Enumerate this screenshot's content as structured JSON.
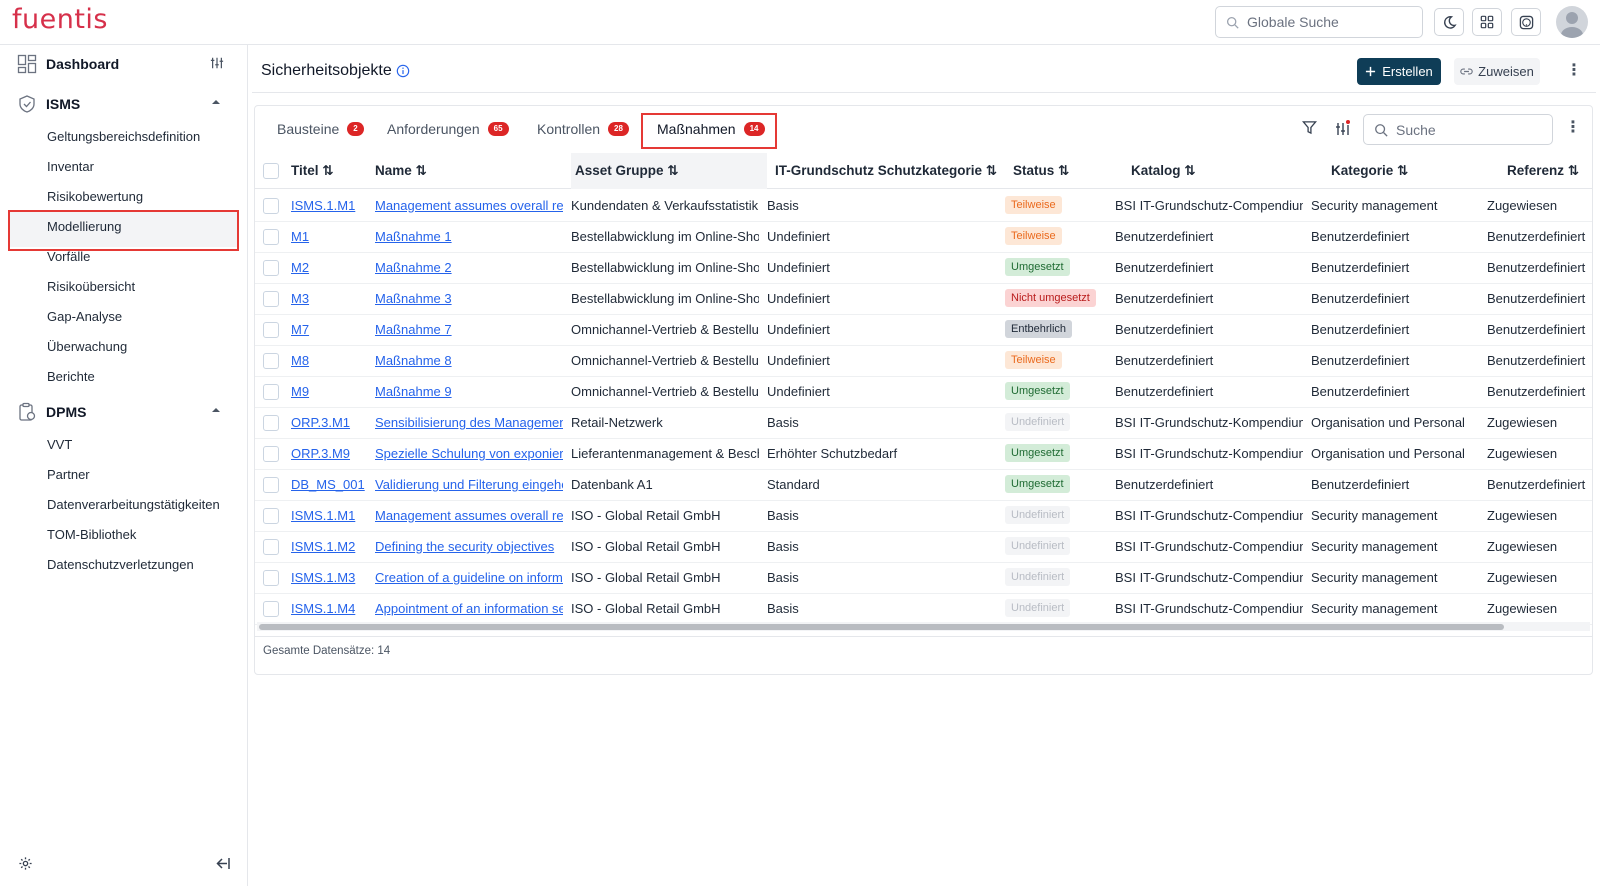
{
  "app": {
    "logo": "fuentis"
  },
  "header": {
    "search_placeholder": "Globale Suche"
  },
  "sidebar": {
    "dashboard": "Dashboard",
    "isms": {
      "label": "ISMS",
      "items": [
        "Geltungsbereichsdefinition",
        "Inventar",
        "Risikobewertung",
        "Modellierung",
        "Vorfälle",
        "Risikoübersicht",
        "Gap-Analyse",
        "Überwachung",
        "Berichte"
      ],
      "active": "Modellierung"
    },
    "dpms": {
      "label": "DPMS",
      "items": [
        "VVT",
        "Partner",
        "Datenverarbeitungstätigkeiten",
        "TOM-Bibliothek",
        "Datenschutzverletzungen"
      ]
    }
  },
  "page": {
    "title": "Sicherheitsobjekte",
    "create_label": "Erstellen",
    "assign_label": "Zuweisen"
  },
  "tabs": [
    {
      "label": "Bausteine",
      "count": "2"
    },
    {
      "label": "Anforderungen",
      "count": "65"
    },
    {
      "label": "Kontrollen",
      "count": "28"
    },
    {
      "label": "Maßnahmen",
      "count": "14"
    }
  ],
  "active_tab": "Maßnahmen",
  "table_search_placeholder": "Suche",
  "columns": [
    "Titel",
    "Name",
    "Asset Gruppe",
    "IT-Grundschutz Schutzkategorie",
    "Status",
    "Katalog",
    "Kategorie",
    "Referenz"
  ],
  "rows": [
    [
      "ISMS.1.M1",
      "Management assumes overall responsibility",
      "Kundendaten & Verkaufsstatistik",
      "Basis",
      "Teilweise",
      "BSI IT-Grundschutz-Compendium",
      "Security management",
      "Zugewiesen"
    ],
    [
      "M1",
      "Maßnahme 1",
      "Bestellabwicklung im Online-Shop",
      "Undefiniert",
      "Teilweise",
      "Benutzerdefiniert",
      "Benutzerdefiniert",
      "Benutzerdefiniert"
    ],
    [
      "M2",
      "Maßnahme 2",
      "Bestellabwicklung im Online-Shop",
      "Undefiniert",
      "Umgesetzt",
      "Benutzerdefiniert",
      "Benutzerdefiniert",
      "Benutzerdefiniert"
    ],
    [
      "M3",
      "Maßnahme 3",
      "Bestellabwicklung im Online-Shop",
      "Undefiniert",
      "Nicht umgesetzt",
      "Benutzerdefiniert",
      "Benutzerdefiniert",
      "Benutzerdefiniert"
    ],
    [
      "M7",
      "Maßnahme 7",
      "Omnichannel-Vertrieb & Bestellung",
      "Undefiniert",
      "Entbehrlich",
      "Benutzerdefiniert",
      "Benutzerdefiniert",
      "Benutzerdefiniert"
    ],
    [
      "M8",
      "Maßnahme 8",
      "Omnichannel-Vertrieb & Bestellung",
      "Undefiniert",
      "Teilweise",
      "Benutzerdefiniert",
      "Benutzerdefiniert",
      "Benutzerdefiniert"
    ],
    [
      "M9",
      "Maßnahme 9",
      "Omnichannel-Vertrieb & Bestellung",
      "Undefiniert",
      "Umgesetzt",
      "Benutzerdefiniert",
      "Benutzerdefiniert",
      "Benutzerdefiniert"
    ],
    [
      "ORP.3.M1",
      "Sensibilisierung des Managements",
      "Retail-Netzwerk",
      "Basis",
      "Undefiniert",
      "BSI IT-Grundschutz-Kompendium",
      "Organisation und Personal",
      "Zugewiesen"
    ],
    [
      "ORP.3.M9",
      "Spezielle Schulung von exponierten Personen",
      "Lieferantenmanagement & Beschaffung",
      "Erhöhter Schutzbedarf",
      "Umgesetzt",
      "BSI IT-Grundschutz-Kompendium",
      "Organisation und Personal",
      "Zugewiesen"
    ],
    [
      "DB_MS_001",
      "Validierung und Filterung eingehender Daten",
      "Datenbank A1",
      "Standard",
      "Umgesetzt",
      "Benutzerdefiniert",
      "Benutzerdefiniert",
      "Benutzerdefiniert"
    ],
    [
      "ISMS.1.M1",
      "Management assumes overall responsibility",
      "ISO - Global Retail GmbH",
      "Basis",
      "Undefiniert",
      "BSI IT-Grundschutz-Compendium",
      "Security management",
      "Zugewiesen"
    ],
    [
      "ISMS.1.M2",
      "Defining the security objectives",
      "ISO - Global Retail GmbH",
      "Basis",
      "Undefiniert",
      "BSI IT-Grundschutz-Compendium",
      "Security management",
      "Zugewiesen"
    ],
    [
      "ISMS.1.M3",
      "Creation of a guideline on information security",
      "ISO - Global Retail GmbH",
      "Basis",
      "Undefiniert",
      "BSI IT-Grundschutz-Compendium",
      "Security management",
      "Zugewiesen"
    ],
    [
      "ISMS.1.M4",
      "Appointment of an information security officer",
      "ISO - Global Retail GmbH",
      "Basis",
      "Undefiniert",
      "BSI IT-Grundschutz-Compendium",
      "Security management",
      "Zugewiesen"
    ]
  ],
  "footer": {
    "total": "Gesamte Datensätze: 14"
  },
  "colors": {
    "logo": "#d6304a",
    "primary": "#0f3d57",
    "link": "#2563eb",
    "badge": "#dc2626",
    "highlight": "#e53935"
  },
  "icons": [
    "search-icon",
    "moon-icon",
    "grid-icon",
    "help-icon",
    "user-avatar-icon",
    "dashboard-icon",
    "sliders-icon",
    "shield-icon",
    "chevron-up-icon",
    "clipboard-icon",
    "info-icon",
    "plus-icon",
    "link-icon",
    "kebab-icon",
    "filter-icon",
    "sort-icon",
    "gear-icon",
    "collapse-icon"
  ]
}
